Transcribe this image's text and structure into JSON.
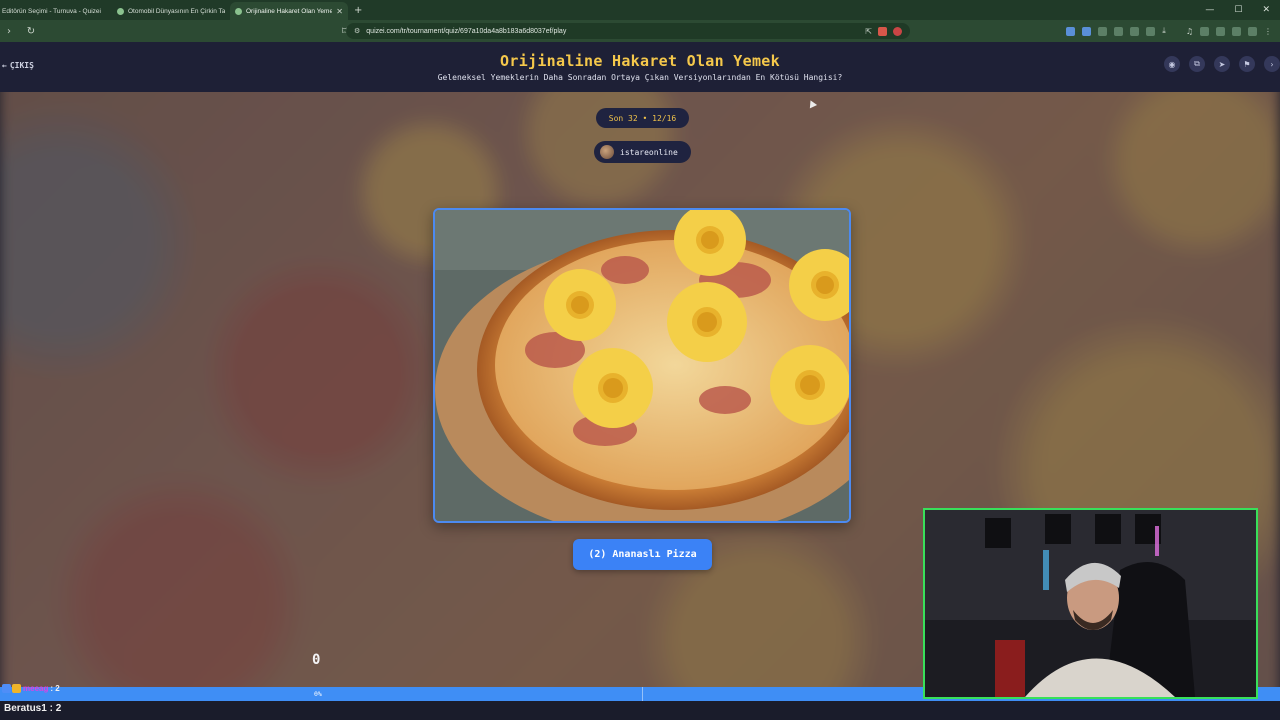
{
  "browser": {
    "tabs": [
      {
        "title": "Editörün Seçimi - Turnuva - Quizei",
        "active": false
      },
      {
        "title": "Otomobil Dünyasının En Çirkin Tasarı",
        "active": false
      },
      {
        "title": "Orijinaline Hakaret Olan Yemek",
        "active": true
      }
    ],
    "new_tab_icon": "plus-icon",
    "url": "quizei.com/tr/tournament/quiz/697a10da4a8b183a6d8037ef/play"
  },
  "header": {
    "exit_label": "ÇIKIŞ",
    "title": "Orijinaline Hakaret Olan Yemek",
    "subtitle": "Geleneksel Yemeklerin Daha Sonradan Ortaya Çıkan Versiyonlarından En Kötüsü Hangisi?",
    "actions": [
      "eye-icon",
      "copy-icon",
      "send-icon",
      "flag-icon"
    ]
  },
  "round": {
    "label": "Son 32 • 12/16"
  },
  "creator": {
    "username": "istareonline"
  },
  "choice": {
    "label": "(2) Ananaslı Pizza"
  },
  "votes": {
    "count": "0",
    "progress_text": "0%",
    "progress": 0
  },
  "chat": {
    "line1_user": "meeag",
    "line1_text": ": 2",
    "line2_user": "Beratus1",
    "line2_text": " : 2"
  },
  "colors": {
    "accent": "#3b82f6",
    "title": "#f5c84b",
    "webcam_border": "#38e05a"
  }
}
